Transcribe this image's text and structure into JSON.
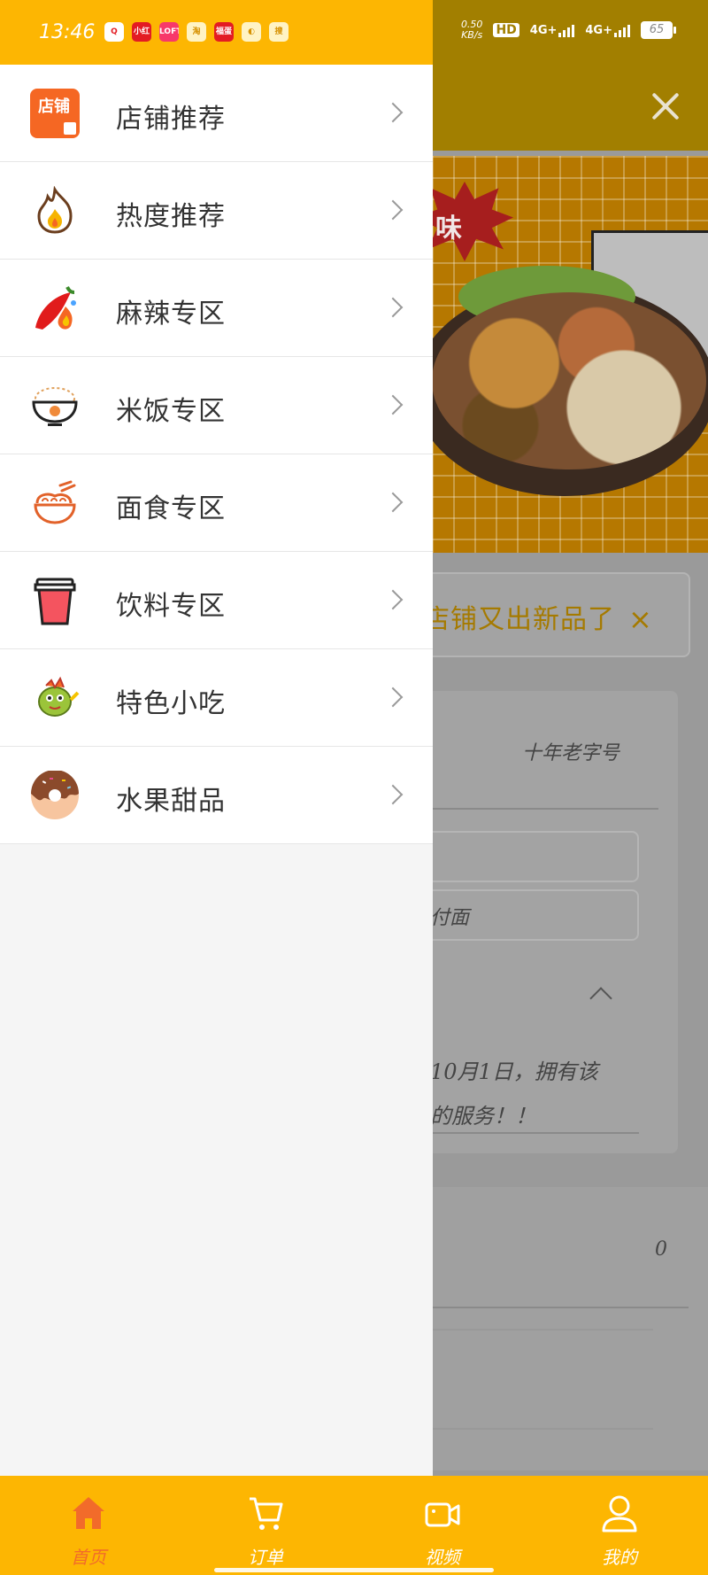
{
  "status_bar": {
    "time": "13:46",
    "notification_icons": [
      {
        "name": "qq-icon",
        "label": "Q"
      },
      {
        "name": "xiaohongshu-icon",
        "label": "小红书"
      },
      {
        "name": "lofter-icon",
        "label": "LOFTER"
      },
      {
        "name": "taobao-icon",
        "label": "淘"
      },
      {
        "name": "tiaoyun-icon",
        "label": "福蛋"
      },
      {
        "name": "planet-app-icon",
        "label": "◐"
      },
      {
        "name": "search-app-icon",
        "label": "搜"
      }
    ],
    "net_speed_value": "0.50",
    "net_speed_unit": "KB/s",
    "hd_label": "HD",
    "net1": "4G+",
    "net2": "4G+",
    "battery": "65"
  },
  "drawer": {
    "items": [
      {
        "label": "店铺推荐",
        "icon": "shop-icon"
      },
      {
        "label": "热度推荐",
        "icon": "flame-icon"
      },
      {
        "label": "麻辣专区",
        "icon": "chili-icon"
      },
      {
        "label": "米饭专区",
        "icon": "rice-bowl-icon"
      },
      {
        "label": "面食专区",
        "icon": "noodles-icon"
      },
      {
        "label": "饮料专区",
        "icon": "drink-cup-icon"
      },
      {
        "label": "特色小吃",
        "icon": "snack-icon"
      },
      {
        "label": "水果甜品",
        "icon": "donut-icon"
      }
    ],
    "shop_icon_text": "店铺"
  },
  "background": {
    "banner_text": "味",
    "notice_text": "店铺又出新品了",
    "notice_close": "×",
    "card_tagline": "十年老字号",
    "card_field_text": "付面",
    "card_desc_line1": "10月1日，拥有该",
    "card_desc_line2": "的服务！！",
    "lower_count": "0"
  },
  "bottom_nav": {
    "items": [
      {
        "label": "首页",
        "icon": "home-icon",
        "active": true
      },
      {
        "label": "订单",
        "icon": "cart-icon",
        "active": false
      },
      {
        "label": "视频",
        "icon": "video-icon",
        "active": false
      },
      {
        "label": "我的",
        "icon": "profile-icon",
        "active": false
      }
    ]
  },
  "colors": {
    "accent": "#fdb602",
    "active_nav": "#f26b2a"
  }
}
